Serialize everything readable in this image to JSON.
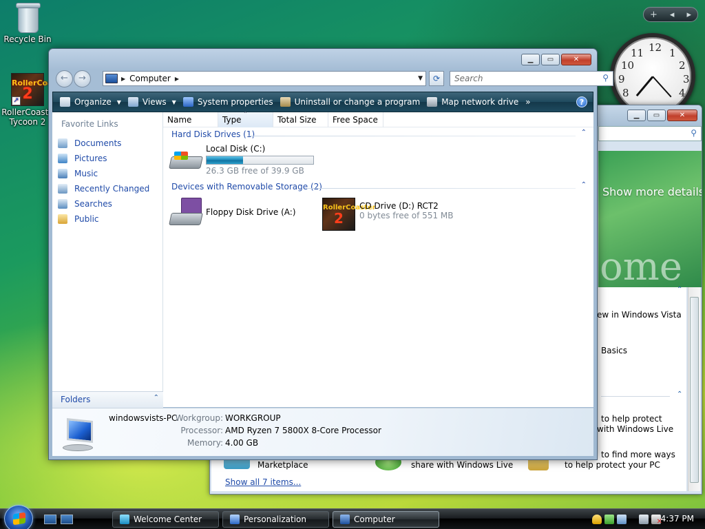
{
  "desktop": {
    "icons": [
      {
        "label": "Recycle Bin"
      },
      {
        "label": "RollerCoaster Tycoon 2",
        "line1": "RollerCoaste",
        "line2": "Tycoon 2"
      }
    ],
    "sidebar_controls": [
      "+",
      "◂",
      "▸"
    ],
    "clock_numbers": {
      "12": "12",
      "1": "1",
      "2": "2",
      "3": "3",
      "4": "4",
      "8": "8",
      "9": "9",
      "10": "10",
      "11": "11"
    }
  },
  "welcome_center": {
    "banner_text": "Show more details",
    "banner_big": "ome",
    "items": [
      {
        "text": "ew in Windows Vista"
      },
      {
        "text": "Basics"
      },
      {
        "text": "to help protect"
      },
      {
        "text": "with Windows Live"
      },
      {
        "text": "to find more ways"
      },
      {
        "text": "to help protect your PC"
      },
      {
        "text": "Marketplace"
      },
      {
        "text": "share with Windows Live"
      }
    ],
    "show_all": "Show all 7 items..."
  },
  "explorer": {
    "address": {
      "location": "Computer"
    },
    "search_placeholder": "Search",
    "toolbar": {
      "organize": "Organize",
      "views": "Views",
      "system_properties": "System properties",
      "uninstall": "Uninstall or change a program",
      "map_drive": "Map network drive",
      "more": "»"
    },
    "nav": {
      "header": "Favorite Links",
      "items": [
        {
          "label": "Documents"
        },
        {
          "label": "Pictures"
        },
        {
          "label": "Music"
        },
        {
          "label": "Recently Changed"
        },
        {
          "label": "Searches"
        },
        {
          "label": "Public"
        }
      ],
      "folders": "Folders"
    },
    "columns": [
      "Name",
      "Type",
      "Total Size",
      "Free Space"
    ],
    "groups": [
      {
        "title": "Hard Disk Drives (1)",
        "items": [
          {
            "name": "Local Disk (C:)",
            "free_text": "26.3 GB free of 39.9 GB",
            "used_fraction": 0.34
          }
        ]
      },
      {
        "title": "Devices with Removable Storage (2)",
        "items": [
          {
            "name": "Floppy Disk Drive (A:)"
          },
          {
            "name": "CD Drive (D:) RCT2",
            "free_text": "0 bytes free of 551 MB"
          }
        ]
      }
    ],
    "details": {
      "pc_name": "windowsvists-PC",
      "workgroup_label": "Workgroup:",
      "workgroup": "WORKGROUP",
      "processor_label": "Processor:",
      "processor": "AMD Ryzen 7 5800X 8-Core Processor",
      "memory_label": "Memory:",
      "memory": "4.00 GB"
    }
  },
  "taskbar": {
    "tasks": [
      {
        "label": "Welcome Center"
      },
      {
        "label": "Personalization"
      },
      {
        "label": "Computer"
      }
    ],
    "time": "4:37 PM"
  }
}
